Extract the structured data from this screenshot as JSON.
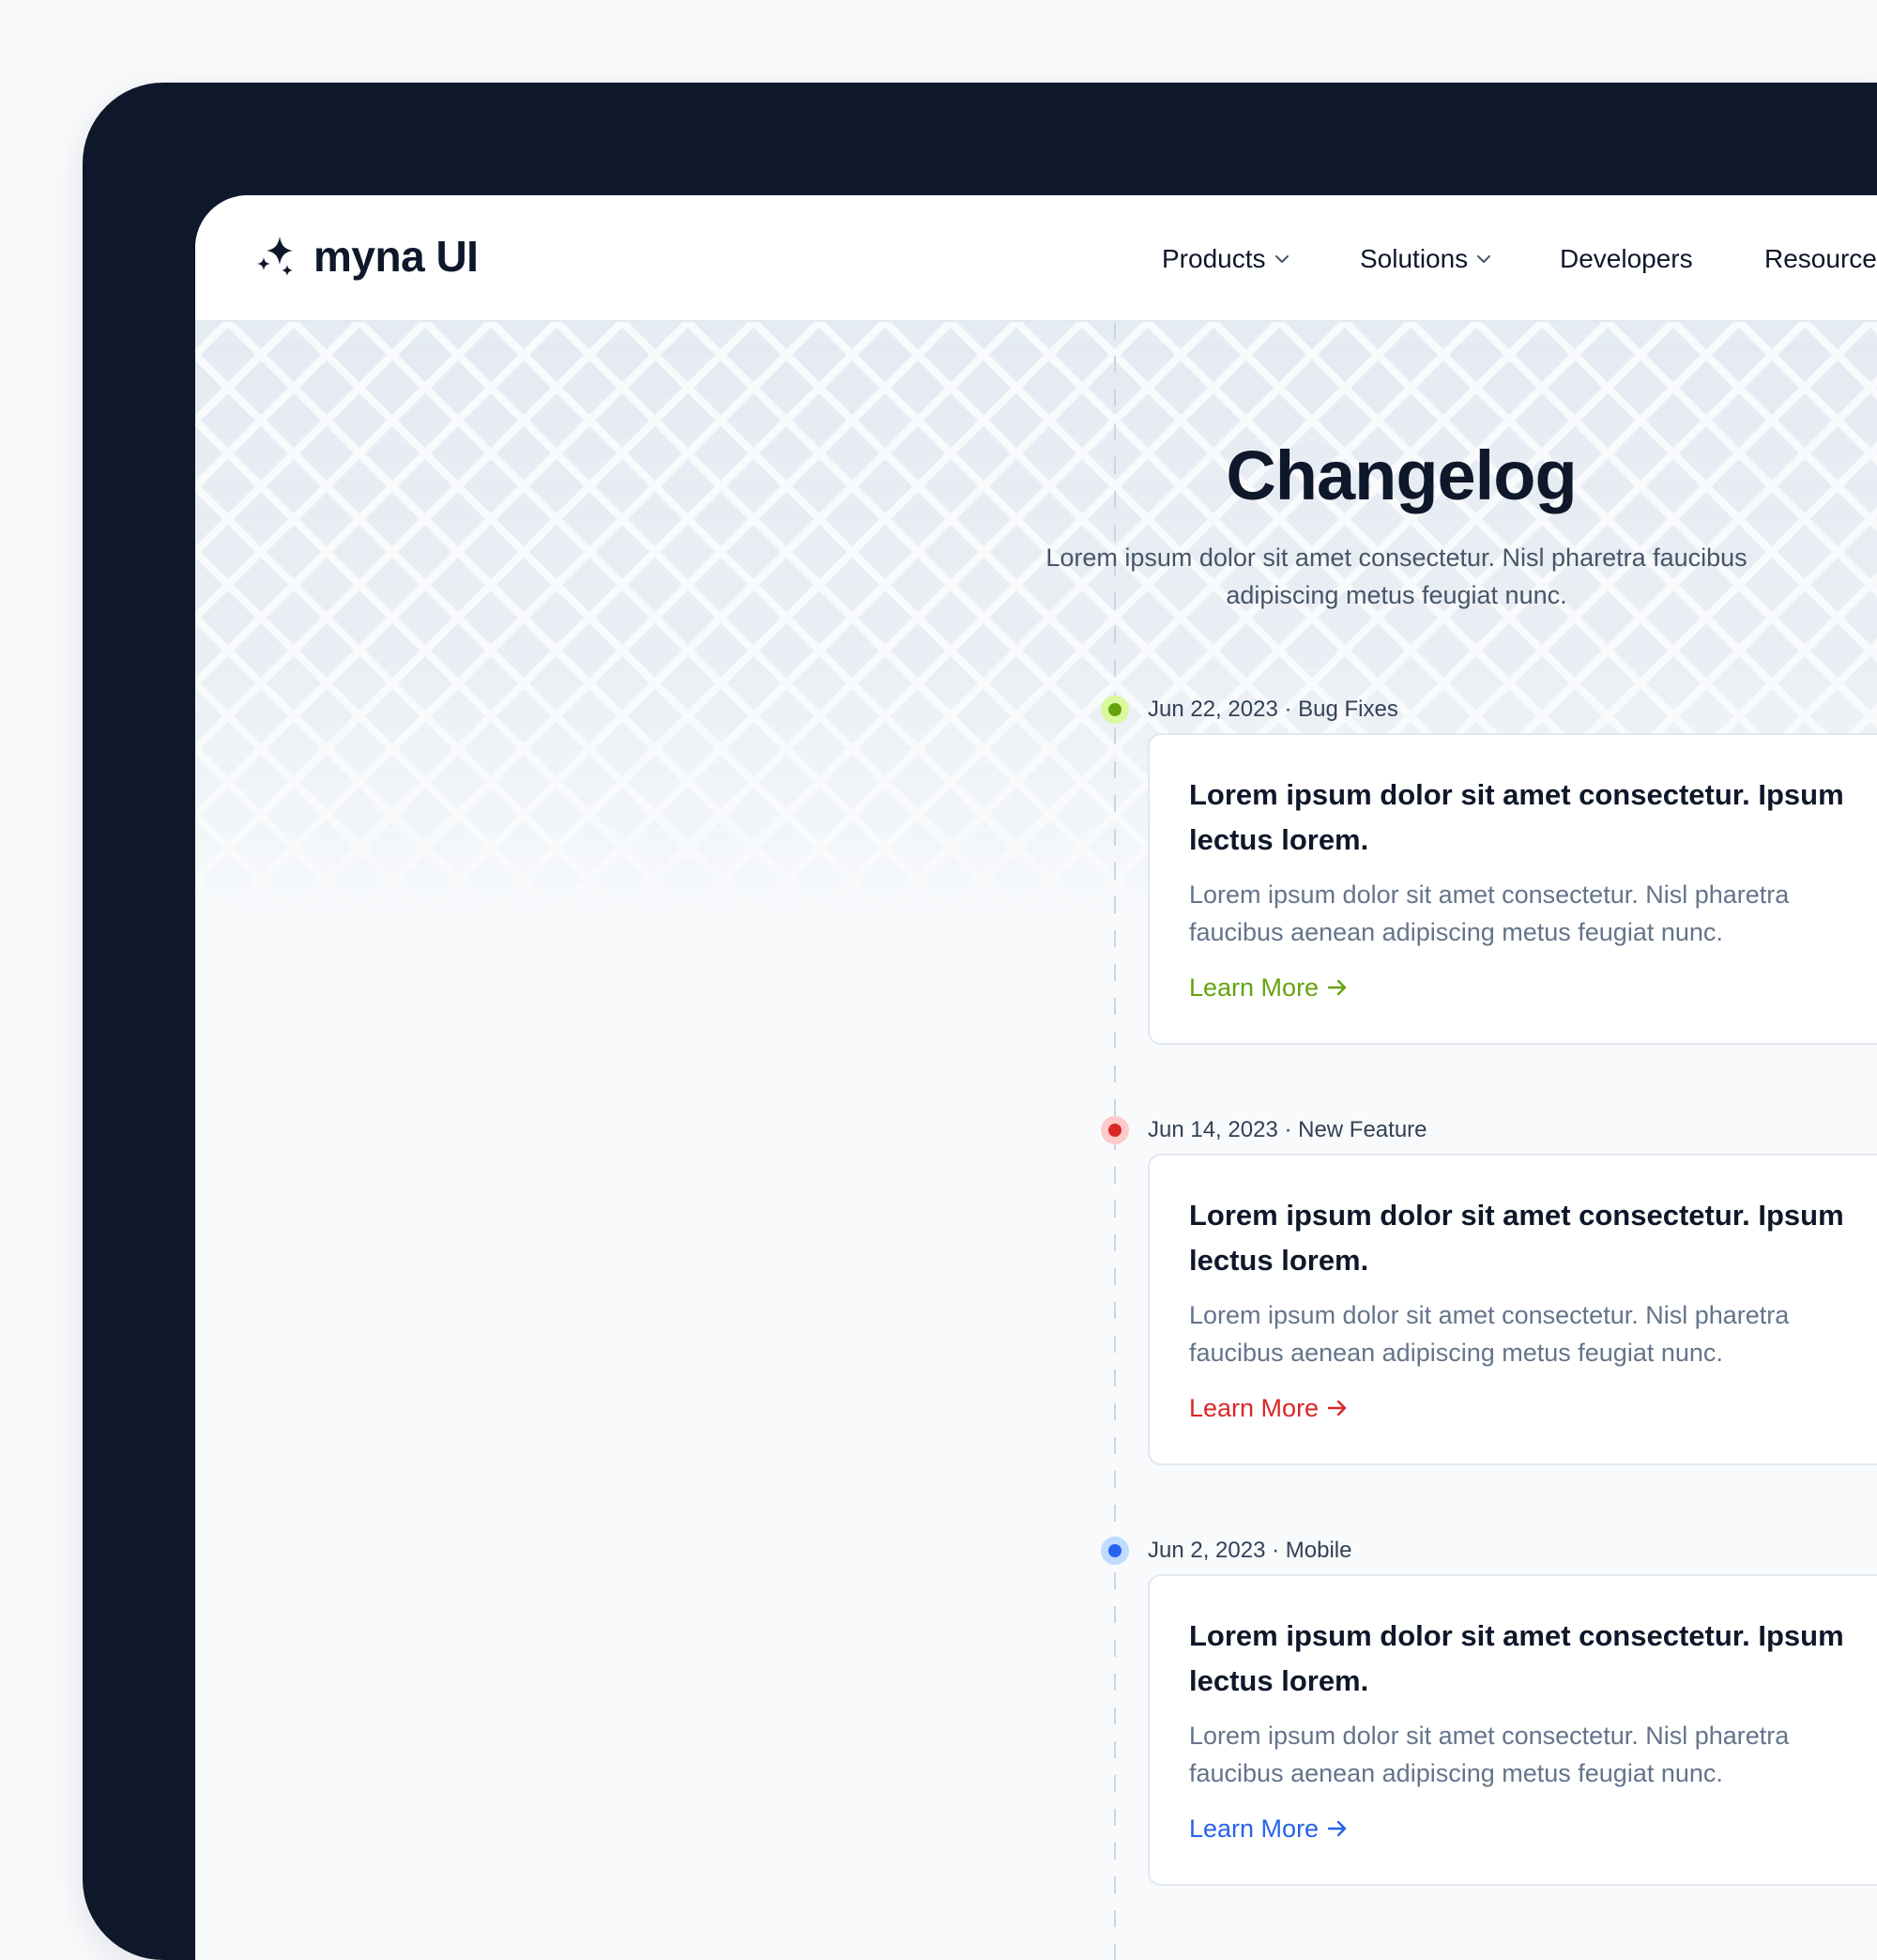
{
  "brand": {
    "name": "myna UI",
    "icon": "sparkles-icon"
  },
  "nav": {
    "items": [
      {
        "label": "Products",
        "has_dropdown": true
      },
      {
        "label": "Solutions",
        "has_dropdown": true
      },
      {
        "label": "Developers",
        "has_dropdown": false
      },
      {
        "label": "Resources",
        "has_dropdown": true
      }
    ]
  },
  "hero": {
    "title": "Changelog",
    "subtitle": "Lorem ipsum dolor sit amet consectetur. Nisl pharetra faucibus adipiscing metus feugiat nunc."
  },
  "entries": [
    {
      "meta": "Jun 22, 2023 · Bug Fixes",
      "color": "#65a30d",
      "halo": "#d9f99d",
      "heading": "Lorem ipsum dolor sit amet consectetur. Ipsum lectus lorem.",
      "body": "Lorem ipsum dolor sit amet consectetur. Nisl pharetra faucibus aenean adipiscing metus feugiat nunc.",
      "link": "Learn More"
    },
    {
      "meta": "Jun 14, 2023 · New Feature",
      "color": "#dc2626",
      "halo": "#fecaca",
      "heading": "Lorem ipsum dolor sit amet consectetur. Ipsum lectus lorem.",
      "body": "Lorem ipsum dolor sit amet consectetur. Nisl pharetra faucibus aenean adipiscing metus feugiat nunc.",
      "link": "Learn More"
    },
    {
      "meta": "Jun 2, 2023 · Mobile",
      "color": "#2563eb",
      "halo": "#bfdbfe",
      "heading": "Lorem ipsum dolor sit amet consectetur. Ipsum lectus lorem.",
      "body": "Lorem ipsum dolor sit amet consectetur. Nisl pharetra faucibus aenean adipiscing metus feugiat nunc.",
      "link": "Learn More"
    }
  ],
  "icons": {
    "nav_dropdown": "chevron-down-icon",
    "link_arrow": "arrow-right-icon"
  },
  "colors": {
    "device_frame": "#0f172a",
    "background": "#f8fafc",
    "text_primary": "#0f172a",
    "text_muted": "#64748b",
    "border": "#e2e8f0"
  }
}
